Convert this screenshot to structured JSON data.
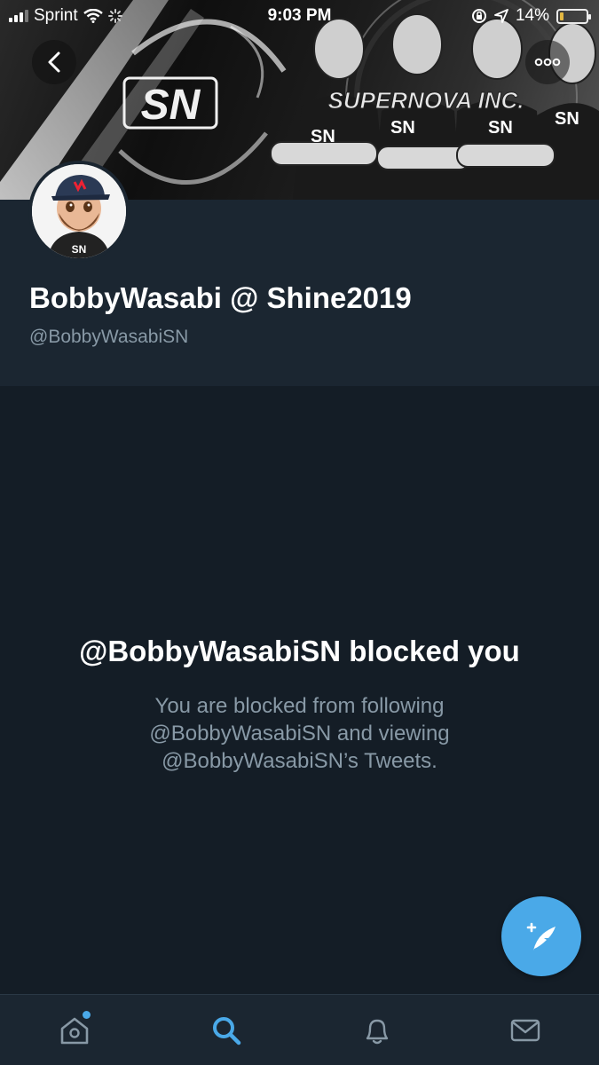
{
  "status_bar": {
    "carrier": "Sprint",
    "time": "9:03 PM",
    "battery_percent": "14%",
    "battery_level": 0.14
  },
  "banner": {
    "team_text": "SUPERNOVA INC.",
    "logo_text": "SN"
  },
  "profile": {
    "display_name": "BobbyWasabi @ Shine2019",
    "handle": "@BobbyWasabiSN"
  },
  "blocked": {
    "title": "@BobbyWasabiSN blocked you",
    "line1": "You are blocked from following",
    "line2": "@BobbyWasabiSN and viewing",
    "line3": "@BobbyWasabiSN’s Tweets."
  },
  "tab_bar": {
    "tabs": [
      {
        "icon": "home-icon",
        "active": false,
        "badge": true
      },
      {
        "icon": "search-icon",
        "active": true,
        "badge": false
      },
      {
        "icon": "bell-icon",
        "active": false,
        "badge": false
      },
      {
        "icon": "mail-icon",
        "active": false,
        "badge": false
      }
    ]
  },
  "colors": {
    "accent": "#4aa9e8",
    "background": "#141d26",
    "header_bg": "#1b2631",
    "secondary_text": "#8899a6"
  }
}
